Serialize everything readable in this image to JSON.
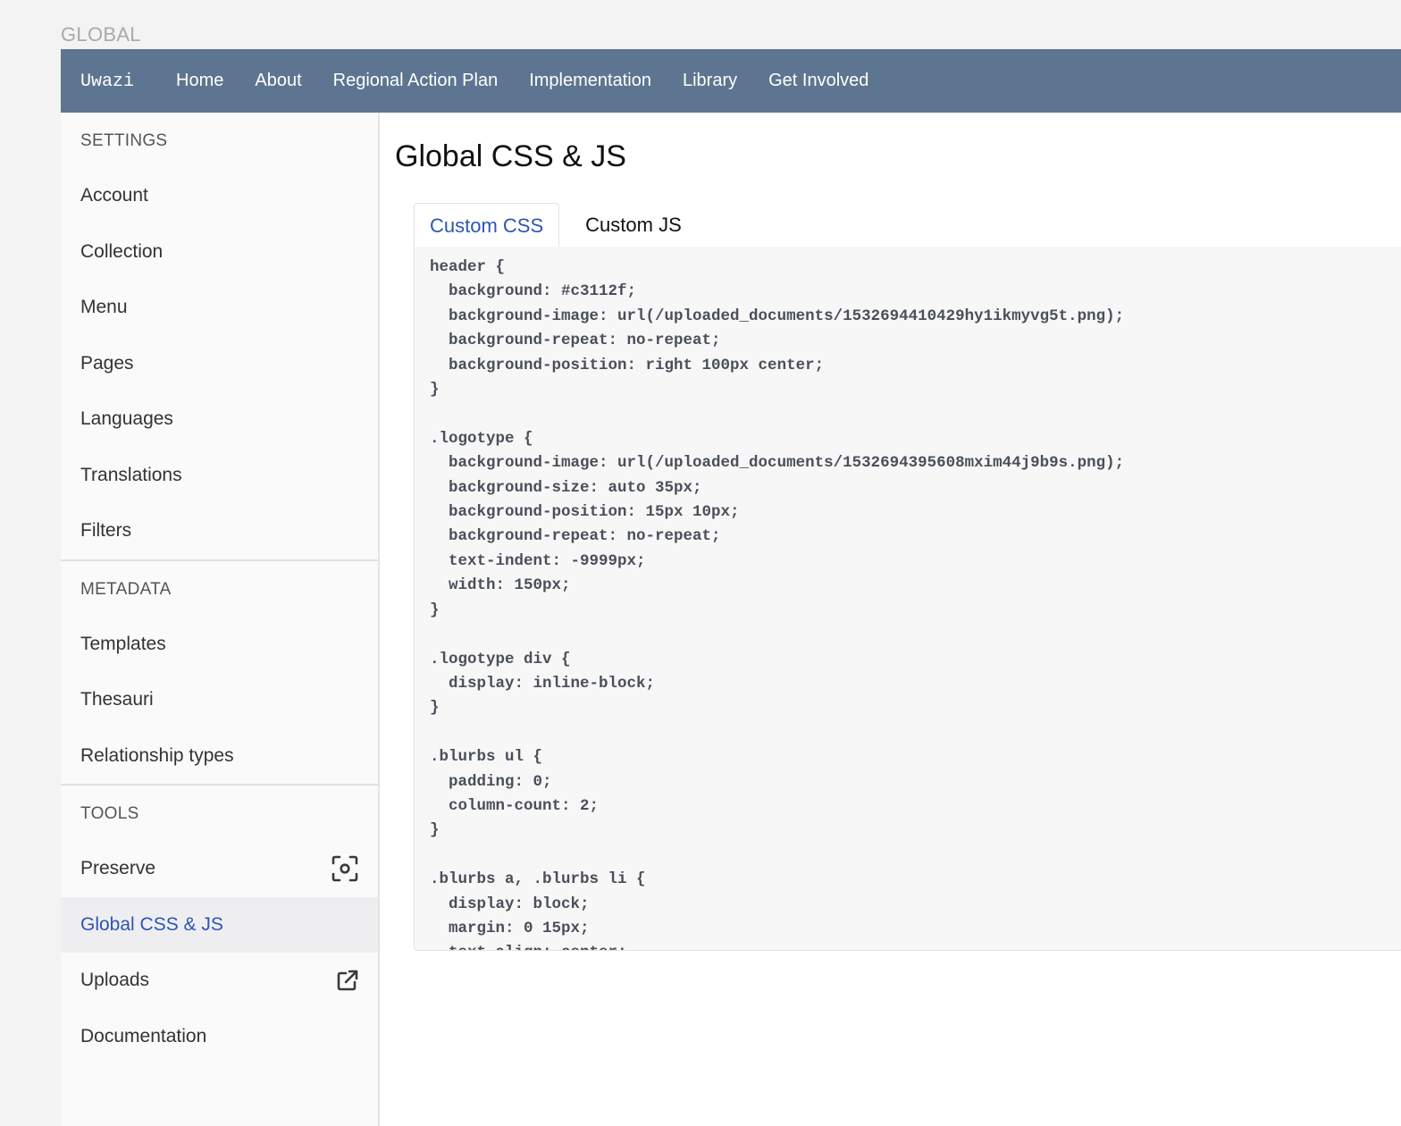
{
  "top_label": "GLOBAL",
  "navbar": {
    "brand": "Uwazi",
    "links": [
      "Home",
      "About",
      "Regional Action Plan",
      "Implementation",
      "Library",
      "Get Involved"
    ]
  },
  "sidebar": {
    "settings": {
      "header": "SETTINGS",
      "items": [
        "Account",
        "Collection",
        "Menu",
        "Pages",
        "Languages",
        "Translations",
        "Filters"
      ]
    },
    "metadata": {
      "header": "METADATA",
      "items": [
        "Templates",
        "Thesauri",
        "Relationship types"
      ]
    },
    "tools": {
      "header": "TOOLS",
      "items": [
        {
          "label": "Preserve",
          "icon": "preserve-icon"
        },
        {
          "label": "Global CSS & JS",
          "active": true
        },
        {
          "label": "Uploads",
          "icon": "external-link-icon"
        },
        {
          "label": "Documentation"
        }
      ]
    }
  },
  "main": {
    "title": "Global CSS & JS",
    "tabs": [
      {
        "label": "Custom CSS",
        "active": true
      },
      {
        "label": "Custom JS",
        "active": false
      }
    ],
    "code": "header {\n  background: #c3112f;\n  background-image: url(/uploaded_documents/1532694410429hy1ikmyvg5t.png);\n  background-repeat: no-repeat;\n  background-position: right 100px center;\n}\n\n.logotype {\n  background-image: url(/uploaded_documents/1532694395608mxim44j9b9s.png);\n  background-size: auto 35px;\n  background-position: 15px 10px;\n  background-repeat: no-repeat;\n  text-indent: -9999px;\n  width: 150px;\n}\n\n.logotype div {\n  display: inline-block;\n}\n\n.blurbs ul {\n  padding: 0;\n  column-count: 2;\n}\n\n.blurbs a, .blurbs li {\n  display: block;\n  margin: 0 15px;\n  text-align: center;"
  },
  "colors": {
    "navbar": "#5d7590",
    "active_accent": "#2e55b3"
  }
}
